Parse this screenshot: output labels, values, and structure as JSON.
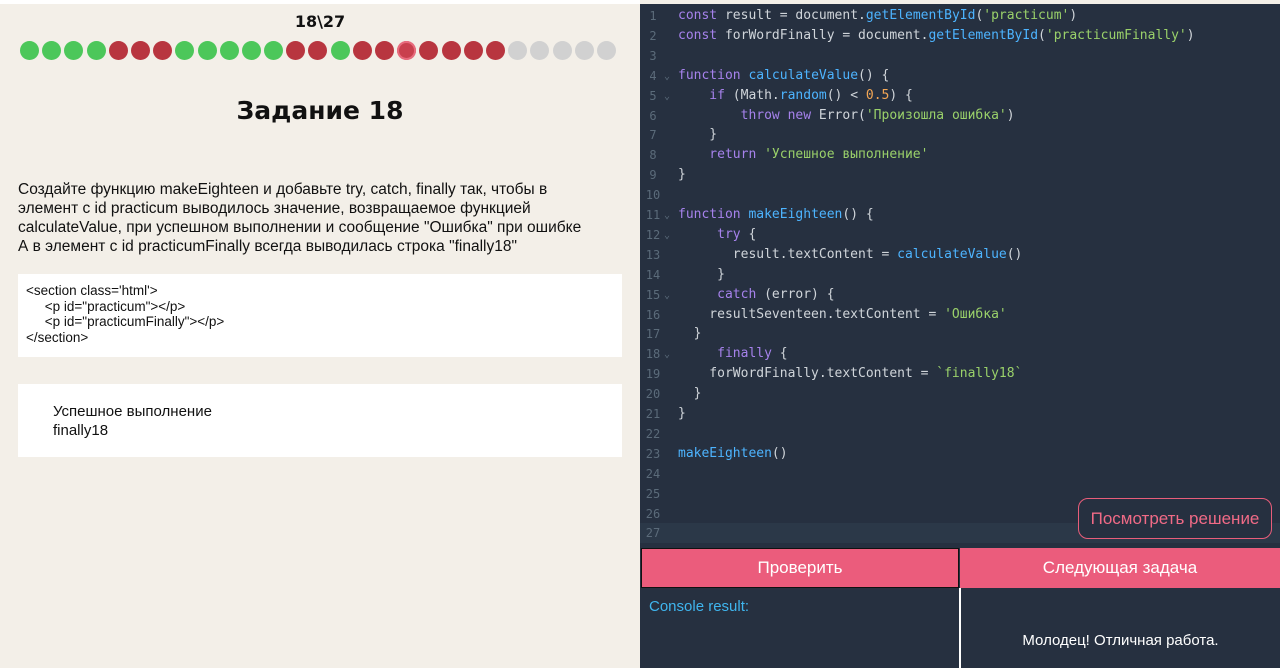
{
  "progress": {
    "label": "18\\27",
    "dots": [
      {
        "status": "correct",
        "color": "#4cc75a"
      },
      {
        "status": "correct",
        "color": "#4cc75a"
      },
      {
        "status": "correct",
        "color": "#4cc75a"
      },
      {
        "status": "correct",
        "color": "#4cc75a"
      },
      {
        "status": "wrong",
        "color": "#b8353f"
      },
      {
        "status": "wrong",
        "color": "#b8353f"
      },
      {
        "status": "wrong",
        "color": "#b8353f"
      },
      {
        "status": "correct",
        "color": "#4cc75a"
      },
      {
        "status": "correct",
        "color": "#4cc75a"
      },
      {
        "status": "correct",
        "color": "#4cc75a"
      },
      {
        "status": "correct",
        "color": "#4cc75a"
      },
      {
        "status": "correct",
        "color": "#4cc75a"
      },
      {
        "status": "wrong",
        "color": "#b8353f"
      },
      {
        "status": "wrong",
        "color": "#b8353f"
      },
      {
        "status": "correct",
        "color": "#4cc75a"
      },
      {
        "status": "wrong",
        "color": "#b8353f"
      },
      {
        "status": "wrong",
        "color": "#b8353f"
      },
      {
        "status": "current",
        "color": "#c9404e"
      },
      {
        "status": "wrong",
        "color": "#b8353f"
      },
      {
        "status": "wrong",
        "color": "#b8353f"
      },
      {
        "status": "wrong",
        "color": "#b8353f"
      },
      {
        "status": "wrong",
        "color": "#b8353f"
      },
      {
        "status": "pending",
        "color": "#d1d1d1"
      },
      {
        "status": "pending",
        "color": "#d1d1d1"
      },
      {
        "status": "pending",
        "color": "#d1d1d1"
      },
      {
        "status": "pending",
        "color": "#d1d1d1"
      },
      {
        "status": "pending",
        "color": "#d1d1d1"
      }
    ]
  },
  "task": {
    "title": "Задание 18",
    "description": [
      "Создайте функцию makeEighteen и добавьте try, catch, finally так, чтобы в",
      "элемент с id practicum выводилось значение, возвращаемое функцией",
      "calculateValue, при успешном выполнении и сообщение \"Ошибка\" при ошибке",
      "А в элемент с id practicumFinally всегда выводилась строка \"finally18\""
    ],
    "html_snippet": [
      "<section class='html'>",
      "     <p id=\"practicum\"></p>",
      "     <p id=\"practicumFinally\"></p>",
      "</section>"
    ],
    "result": [
      "Успешное выполнение",
      "finally18"
    ]
  },
  "editor": {
    "lines": [
      {
        "n": "1",
        "fold": false,
        "tokens": [
          [
            "kw",
            "const "
          ],
          [
            "pl",
            "result = document."
          ],
          [
            "fn",
            "getElementById"
          ],
          [
            "pl",
            "("
          ],
          [
            "str",
            "'practicum'"
          ],
          [
            "pl",
            ")"
          ]
        ]
      },
      {
        "n": "2",
        "fold": false,
        "tokens": [
          [
            "kw",
            "const "
          ],
          [
            "pl",
            "forWordFinally = document."
          ],
          [
            "fn",
            "getElementById"
          ],
          [
            "pl",
            "("
          ],
          [
            "str",
            "'practicumFinally'"
          ],
          [
            "pl",
            ")"
          ]
        ]
      },
      {
        "n": "3",
        "fold": false,
        "tokens": []
      },
      {
        "n": "4",
        "fold": true,
        "tokens": [
          [
            "kw",
            "function "
          ],
          [
            "fn",
            "calculateValue"
          ],
          [
            "pl",
            "() {"
          ]
        ]
      },
      {
        "n": "5",
        "fold": true,
        "tokens": [
          [
            "kw",
            "    if "
          ],
          [
            "pl",
            "(Math."
          ],
          [
            "fn",
            "random"
          ],
          [
            "pl",
            "() < "
          ],
          [
            "num",
            "0.5"
          ],
          [
            "pl",
            ") {"
          ]
        ]
      },
      {
        "n": "6",
        "fold": false,
        "tokens": [
          [
            "kw",
            "        throw new "
          ],
          [
            "pl",
            "Error("
          ],
          [
            "str",
            "'Произошла ошибка'"
          ],
          [
            "pl",
            ")"
          ]
        ]
      },
      {
        "n": "7",
        "fold": false,
        "tokens": [
          [
            "pl",
            "    }"
          ]
        ]
      },
      {
        "n": "8",
        "fold": false,
        "tokens": [
          [
            "kw",
            "    return "
          ],
          [
            "str",
            "'Успешное выполнение'"
          ]
        ]
      },
      {
        "n": "9",
        "fold": false,
        "tokens": [
          [
            "pl",
            "}"
          ]
        ]
      },
      {
        "n": "10",
        "fold": false,
        "tokens": []
      },
      {
        "n": "11",
        "fold": true,
        "tokens": [
          [
            "kw",
            "function "
          ],
          [
            "fn",
            "makeEighteen"
          ],
          [
            "pl",
            "() {"
          ]
        ]
      },
      {
        "n": "12",
        "fold": true,
        "tokens": [
          [
            "kw",
            "     try "
          ],
          [
            "pl",
            "{"
          ]
        ]
      },
      {
        "n": "13",
        "fold": false,
        "tokens": [
          [
            "pl",
            "       result.textContent = "
          ],
          [
            "fn",
            "calculateValue"
          ],
          [
            "pl",
            "()"
          ]
        ]
      },
      {
        "n": "14",
        "fold": false,
        "tokens": [
          [
            "pl",
            "     }"
          ]
        ]
      },
      {
        "n": "15",
        "fold": true,
        "tokens": [
          [
            "kw",
            "     catch "
          ],
          [
            "pl",
            "(error) {"
          ]
        ]
      },
      {
        "n": "16",
        "fold": false,
        "tokens": [
          [
            "pl",
            "    resultSeventeen.textContent = "
          ],
          [
            "str",
            "'Ошибка'"
          ]
        ]
      },
      {
        "n": "17",
        "fold": false,
        "tokens": [
          [
            "pl",
            "  }"
          ]
        ]
      },
      {
        "n": "18",
        "fold": true,
        "tokens": [
          [
            "kw",
            "     finally "
          ],
          [
            "pl",
            "{"
          ]
        ]
      },
      {
        "n": "19",
        "fold": false,
        "tokens": [
          [
            "pl",
            "    forWordFinally.textContent = "
          ],
          [
            "str",
            "`finally18`"
          ]
        ]
      },
      {
        "n": "20",
        "fold": false,
        "tokens": [
          [
            "pl",
            "  }"
          ]
        ]
      },
      {
        "n": "21",
        "fold": false,
        "tokens": [
          [
            "pl",
            "}"
          ]
        ]
      },
      {
        "n": "22",
        "fold": false,
        "tokens": []
      },
      {
        "n": "23",
        "fold": false,
        "tokens": [
          [
            "fn",
            "makeEighteen"
          ],
          [
            "pl",
            "()"
          ]
        ]
      },
      {
        "n": "24",
        "fold": false,
        "tokens": []
      },
      {
        "n": "25",
        "fold": false,
        "tokens": []
      },
      {
        "n": "26",
        "fold": false,
        "tokens": []
      },
      {
        "n": "27",
        "fold": false,
        "tokens": [],
        "active": true
      }
    ]
  },
  "buttons": {
    "view_solution": "Посмотреть решение",
    "check": "Проверить",
    "next_task": "Следующая задача"
  },
  "console": {
    "label": "Console result:"
  },
  "feedback": {
    "message": "Молодец! Отличная работа."
  },
  "colors": {
    "accent": "#eb5c7c",
    "editor_bg": "#263040",
    "correct": "#4cc75a",
    "wrong": "#b8353f",
    "pending": "#d1d1d1"
  }
}
